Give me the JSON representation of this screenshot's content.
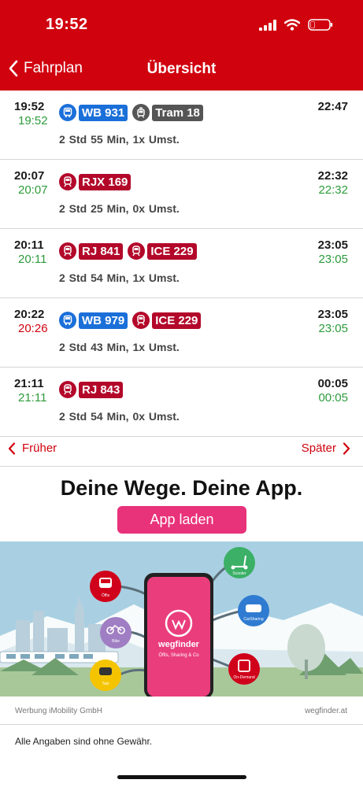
{
  "status_bar": {
    "time": "19:52"
  },
  "nav": {
    "back_label": "Fahrplan",
    "title": "Übersicht"
  },
  "colors": {
    "brand_red": "#d0020e",
    "ontime_green": "#2e9b3b",
    "bus_blue": "#1b6fd9",
    "train_red": "#b3082a",
    "tram_gray": "#555555",
    "ad_pink": "#e8327a"
  },
  "connections": [
    {
      "dep": "19:52",
      "dep_rt": "19:52",
      "dep_rt_status": "ontime",
      "arr": "22:47",
      "arr_rt": "",
      "arr_rt_status": "ontime",
      "products": [
        {
          "icon": "bus-icon",
          "color": "blue",
          "label": "WB 931"
        },
        {
          "icon": "tram-icon",
          "color": "gray",
          "label": "Tram 18"
        }
      ],
      "duration": "2 Std 55 Min,  1x Umst."
    },
    {
      "dep": "20:07",
      "dep_rt": "20:07",
      "dep_rt_status": "ontime",
      "arr": "22:32",
      "arr_rt": "22:32",
      "arr_rt_status": "ontime",
      "products": [
        {
          "icon": "train-icon",
          "color": "red",
          "label": "RJX 169"
        }
      ],
      "duration": "2 Std 25 Min,  0x Umst."
    },
    {
      "dep": "20:11",
      "dep_rt": "20:11",
      "dep_rt_status": "ontime",
      "arr": "23:05",
      "arr_rt": "23:05",
      "arr_rt_status": "ontime",
      "products": [
        {
          "icon": "train-icon",
          "color": "red",
          "label": "RJ 841"
        },
        {
          "icon": "train-icon",
          "color": "red",
          "label": "ICE 229"
        }
      ],
      "duration": "2 Std 54 Min,  1x Umst."
    },
    {
      "dep": "20:22",
      "dep_rt": "20:26",
      "dep_rt_status": "delay",
      "arr": "23:05",
      "arr_rt": "23:05",
      "arr_rt_status": "ontime",
      "products": [
        {
          "icon": "bus-icon",
          "color": "blue",
          "label": "WB 979"
        },
        {
          "icon": "train-icon",
          "color": "red",
          "label": "ICE 229"
        }
      ],
      "duration": "2 Std 43 Min,  1x Umst."
    },
    {
      "dep": "21:11",
      "dep_rt": "21:11",
      "dep_rt_status": "ontime",
      "arr": "00:05",
      "arr_rt": "00:05",
      "arr_rt_status": "ontime",
      "products": [
        {
          "icon": "train-icon",
          "color": "red",
          "label": "RJ 843"
        }
      ],
      "duration": "2 Std 54 Min,  0x Umst."
    }
  ],
  "paging": {
    "prev_label": "Früher",
    "next_label": "Später"
  },
  "ad": {
    "headline": "Deine Wege. Deine App.",
    "button_label": "App laden",
    "app_name": "wegfinder",
    "app_tagline": "Öffis, Sharing & Co",
    "bubbles": {
      "oeffis": "Öffis",
      "bike": "Bike",
      "taxi": "Taxi",
      "scooter": "Scooter",
      "carsharing": "CarSharing",
      "ondemand": "On-Demand"
    },
    "credit": "Werbung iMobility GmbH",
    "url": "wegfinder.at"
  },
  "disclaimer": "Alle Angaben sind ohne Gewähr."
}
